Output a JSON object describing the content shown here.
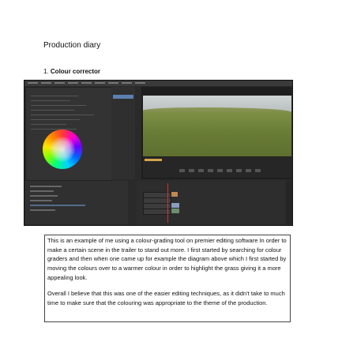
{
  "document": {
    "title": "Production diary",
    "section_number": "1.",
    "section_title": "Colour corrector",
    "paragraph_1": "This is an example of me using a colour-grading tool on premier editing software In order to make a certain scene in the trailer to stand out more. I first started by searching for colour graders and then when one came up for example the diagram above which I first started by moving the colours over to a warmer colour in order to highlight the grass giving it a more appealing look.",
    "paragraph_2": "Overall I believe that this was one of the easier editing techniques, as it didn't take to much time to make sure that the colouring was appropriate to the theme of the production."
  },
  "screenshot": {
    "image": "premiere-colour-corrector-screenshot",
    "colors": {
      "ui_background": "#2a2a2a",
      "timecode": "#d6a54a",
      "playhead": "#cc3333",
      "grass": "#6a7d36",
      "sky": "#c6cbcc"
    }
  }
}
